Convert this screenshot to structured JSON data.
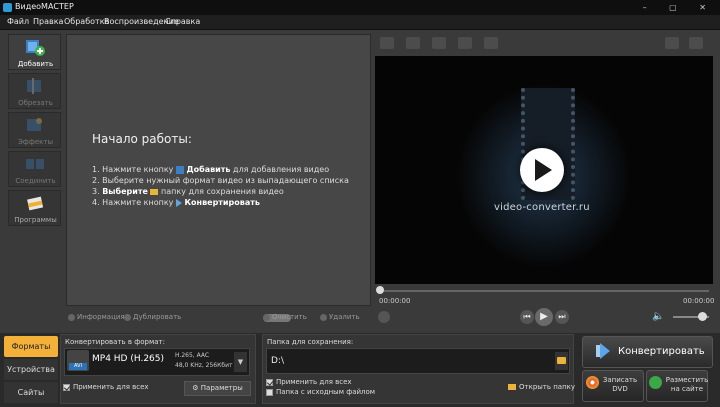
{
  "window": {
    "title": "ВидеоМАСТЕР",
    "controls": "– ▢ ✕"
  },
  "menu": [
    "Файл",
    "Правка",
    "Обработка",
    "Воспроизведение",
    "Справка"
  ],
  "sidebar": [
    {
      "label": "Добавить",
      "icon": "add-video-icon"
    },
    {
      "label": "Обрезать",
      "icon": "trim-icon"
    },
    {
      "label": "Эффекты",
      "icon": "effects-icon"
    },
    {
      "label": "Соединить",
      "icon": "join-icon"
    },
    {
      "label": "Программы",
      "icon": "programs-icon"
    }
  ],
  "getting_started": {
    "title": "Начало работы:",
    "step1_pre": "1. Нажмите кнопку",
    "step1_bold": "Добавить",
    "step1_post": "для добавления видео",
    "step2": "2. Выберите нужный формат видео из выпадающего списка",
    "step3_bold": "Выберите",
    "step3_pre": "3.",
    "step3_post": "папку для сохранения видео",
    "step4_pre": "4. Нажмите кнопку",
    "step4_bold": "Конвертировать"
  },
  "list_toolbar": {
    "info": "Информация",
    "duplicate": "Дублировать",
    "clear": "Очистить",
    "delete": "Удалить"
  },
  "player": {
    "watermark": "video-converter.ru",
    "time_current": "00:00:00",
    "time_total": "00:00:00",
    "volume": 0.8
  },
  "bottom_tabs": [
    "Форматы",
    "Устройства",
    "Сайты"
  ],
  "format": {
    "label": "Конвертировать в формат:",
    "name": "MP4 HD (H.265)",
    "badge": "AVI",
    "spec_line1": "H.265, AAC",
    "spec_line2": "48,0 KHz, 256Кбит",
    "apply_all": "Применить для всех",
    "params": "Параметры"
  },
  "save": {
    "label": "Папка для сохранения:",
    "path": "D:\\",
    "apply_all": "Применить для всех",
    "source_folder": "Папка с исходным файлом",
    "open_folder": "Открыть папку"
  },
  "actions": {
    "convert": "Конвертировать",
    "dvd_line1": "Записать",
    "dvd_line2": "DVD",
    "site_line1": "Разместить",
    "site_line2": "на сайте"
  },
  "colors": {
    "accent": "#f3b13a",
    "blue": "#2e72b8",
    "green": "#39a845"
  }
}
